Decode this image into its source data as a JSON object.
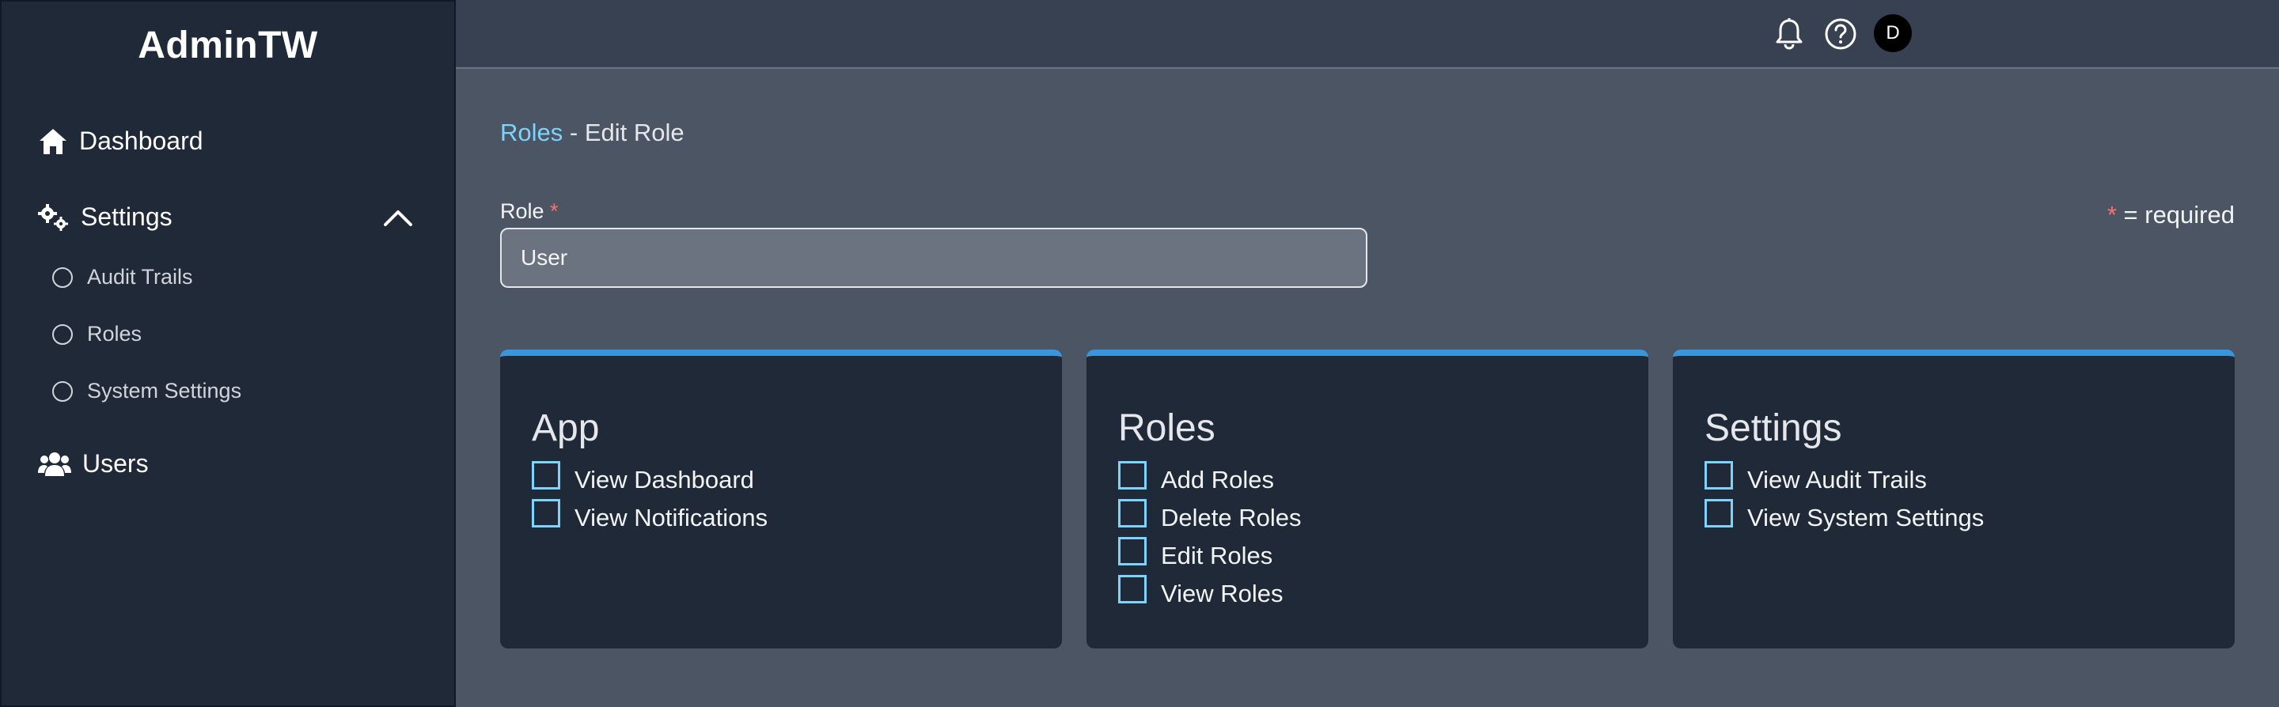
{
  "app": {
    "brand": "AdminTW"
  },
  "sidebar": {
    "dashboard": "Dashboard",
    "settings": "Settings",
    "settings_items": [
      "Audit Trails",
      "Roles",
      "System Settings"
    ],
    "users": "Users"
  },
  "topbar": {
    "avatar_initial": "D"
  },
  "breadcrumb": {
    "parent": "Roles",
    "separator": " - ",
    "current": "Edit Role"
  },
  "form": {
    "role_label": "Role",
    "required_star": "*",
    "required_note": "= required",
    "role_value": "User"
  },
  "cards": [
    {
      "title": "App",
      "permissions": [
        "View Dashboard",
        "View Notifications"
      ]
    },
    {
      "title": "Roles",
      "permissions": [
        "Add Roles",
        "Delete Roles",
        "Edit Roles",
        "View Roles"
      ]
    },
    {
      "title": "Settings",
      "permissions": [
        "View Audit Trails",
        "View System Settings"
      ]
    }
  ],
  "colors": {
    "sidebar_bg": "#1f2937",
    "page_bg": "#4b5563",
    "topbar_bg": "#374151",
    "accent": "#3b95da",
    "link": "#7dd3fc",
    "required": "#f87171"
  },
  "icons": [
    "home-icon",
    "gears-icon",
    "chevron-up-icon",
    "users-icon",
    "bell-icon",
    "help-icon"
  ]
}
